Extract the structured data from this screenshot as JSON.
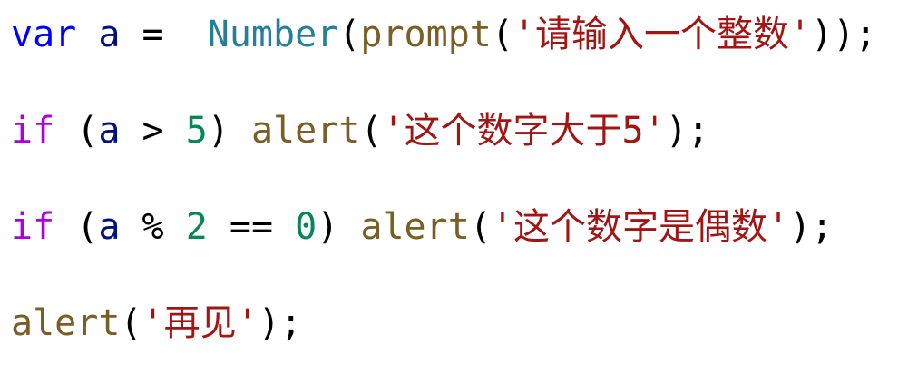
{
  "code": {
    "line1": {
      "kw": "var",
      "sp1": " ",
      "ident": "a",
      "op": " =  ",
      "ctor": "Number",
      "p1": "(",
      "fn": "prompt",
      "p2": "(",
      "str": "'请输入一个整数'",
      "end": "));"
    },
    "line2": {
      "kw": "if",
      "open": " (",
      "ident": "a",
      "op": " > ",
      "num": "5",
      "close": ") ",
      "fn": "alert",
      "p": "(",
      "str": "'这个数字大于5'",
      "end": ");"
    },
    "line3": {
      "kw": "if",
      "open": " (",
      "ident": "a",
      "op1": " % ",
      "num1": "2",
      "op2": " == ",
      "num2": "0",
      "close": ") ",
      "fn": "alert",
      "p": "(",
      "str": "'这个数字是偶数'",
      "end": ");"
    },
    "line4": {
      "fn": "alert",
      "p": "(",
      "str": "'再见'",
      "end": ");"
    }
  },
  "colors": {
    "keyword_var": "#0000ff",
    "keyword_if": "#af00db",
    "identifier": "#001080",
    "constructor": "#267f99",
    "function": "#795e26",
    "number": "#098658",
    "string": "#a31515",
    "background": "#ffffff"
  }
}
